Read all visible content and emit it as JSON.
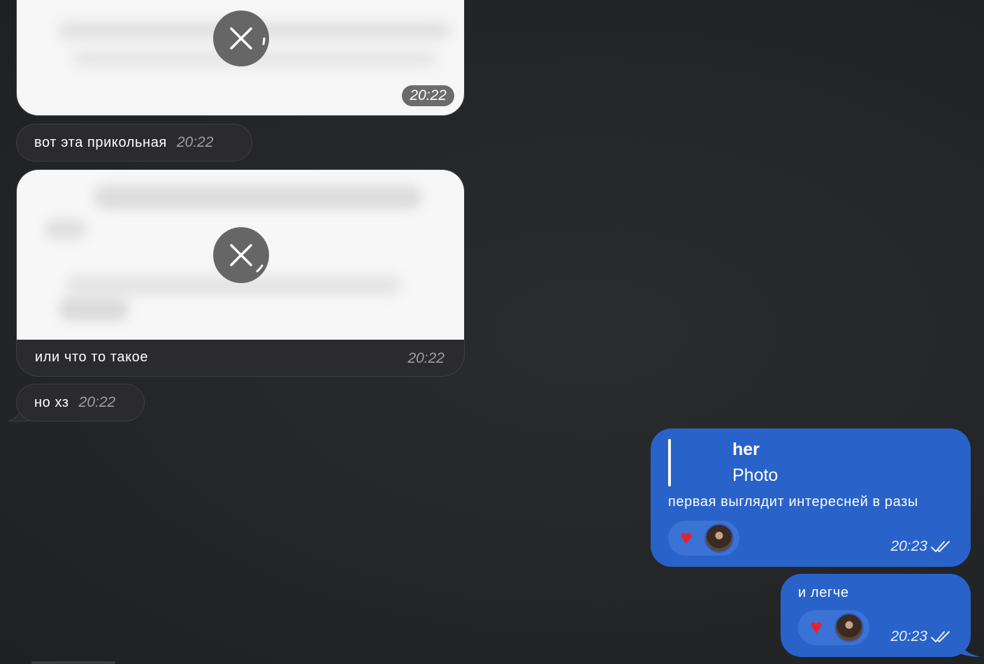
{
  "messages": {
    "photo1": {
      "time": "20:22",
      "status_icon": "close-icon"
    },
    "text1": {
      "text": "вот эта прикольная",
      "time": "20:22"
    },
    "photo2": {
      "caption": "или что то такое",
      "time": "20:22",
      "status_icon": "close-icon"
    },
    "text2": {
      "text": "но хз",
      "time": "20:22"
    },
    "out1": {
      "reply_author": "her",
      "reply_preview": "Photo",
      "text": "первая выглядит интересней в разы",
      "reaction": "heart",
      "time": "20:23",
      "status": "read"
    },
    "out2": {
      "text": "и легче",
      "reaction": "heart",
      "time": "20:23",
      "status": "read"
    }
  },
  "colors": {
    "incoming_bubble": "#2b2b2d",
    "outgoing_bubble": "#2962c8",
    "background": "#26282a"
  }
}
